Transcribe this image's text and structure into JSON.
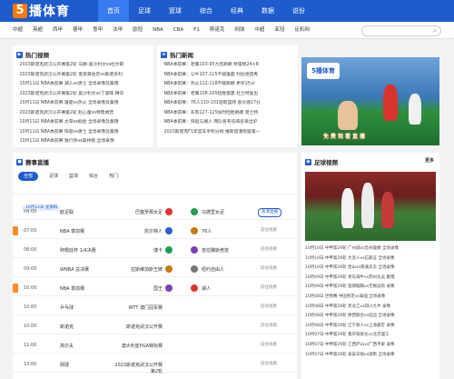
{
  "brand": {
    "mark": "5",
    "name": "播体育"
  },
  "main_nav": [
    "首页",
    "足球",
    "篮球",
    "综合",
    "经典",
    "数据",
    "说份"
  ],
  "sub_nav": [
    "中超",
    "英超",
    "西甲",
    "德甲",
    "意甲",
    "法甲",
    "欧冠",
    "NBA",
    "CBA",
    "F1",
    "斯诺克",
    "网球",
    "中超",
    "亚冠",
    "足彩网"
  ],
  "search": {
    "placeholder": ""
  },
  "hot_videos": {
    "title": "热门视频",
    "items": [
      "2023斯诺克武汉公开赛第2轮 马赫-奥沙利文vs杜尔斯",
      "2023斯诺克武汉公开赛第2轮 墨索美伯尼vs斯诺多利",
      "10月11日 NBA季前赛 湖人vs勇士 全场录像及集锦",
      "2023斯诺克武汉公开赛第2轮 奥沙利文vs丁俊晖 精华",
      "10月11日 NBA季前赛 雄鹿vs热火 全场录像及集锦",
      "2023斯诺克武汉公开赛第2轮 赵心童vs特鲁姆普",
      "10月11日 NBA季前赛 太阳vs掘金 全场录像及集锦",
      "10月11日 NBA季前赛 快船vs勇士 全场录像及集锦",
      "10月11日 NBA季前赛 独行侠vs森林狼 全场录像"
    ]
  },
  "hot_news": {
    "title": "热门新闻",
    "items": [
      "NBA季前赛：老鹰103-95力克鹈鹕 特雷杨24+8",
      "NBA季前赛：公牛107-115不敌雄鹿 利拉德首秀",
      "NBA季前赛：热火112-118不敌鹈鹕 希罗25分",
      "NBA季前赛：老鹰108-105险胜雷霆 杜兰特复出",
      "NBA季前赛：76人110-101轻取篮网 恩比德27分",
      "NBA季前赛：灰熊127-125加时险胜鹈鹕 莫兰特",
      "NBA季前赛：快船与湖人 两队各有伤病名单出炉",
      "2023斯诺克F1年度车手积分榜 维斯塔潘稳居第一"
    ]
  },
  "promo": {
    "badge": "5播体育",
    "slogan": "免费观看直播"
  },
  "schedule": {
    "title": "赛事直播",
    "tabs": [
      "全部",
      "足球",
      "篮球",
      "综合",
      "热门"
    ],
    "date": "10月12日 星期四",
    "rows": [
      {
        "time": "04:00",
        "league": "欧足联",
        "home": "巴塞罗那女足",
        "away": "马德里女足",
        "button": "高清直播",
        "live": true,
        "hot": false
      },
      {
        "time": "07:00",
        "league": "NBA 季前赛",
        "home": "凯尔特人",
        "away": "76人",
        "button": "前往观看",
        "live": false,
        "hot": true
      },
      {
        "time": "08:00",
        "league": "阿根廷杯 1/4决赛",
        "home": "博卡",
        "away": "普拉滕斯竞技",
        "button": "前往观看",
        "live": false,
        "hot": false
      },
      {
        "time": "09:00",
        "league": "WNBA 总决赛",
        "home": "拉斯维加斯王牌",
        "away": "纽约自由人",
        "button": "前往观看",
        "live": false,
        "hot": false
      },
      {
        "time": "10:00",
        "league": "NBA 季前赛",
        "home": "国王",
        "away": "湖人",
        "button": "前往观看",
        "live": false,
        "hot": true
      },
      {
        "time": "10:00",
        "league": "乒乓球",
        "home": "WTT 澳门冠军赛",
        "away": "",
        "button": "前往观看",
        "live": false,
        "hot": false
      },
      {
        "time": "10:00",
        "league": "斯诺克",
        "home": "斯诺克武汉公开赛",
        "away": "",
        "button": "前往观看",
        "live": false,
        "hot": false
      },
      {
        "time": "11:00",
        "league": "高尔夫",
        "home": "澳大利亚PGA锦标赛",
        "away": "",
        "button": "前往观看",
        "live": false,
        "hot": false
      },
      {
        "time": "13:00",
        "league": "网球",
        "home": "2023斯诺克武汉公开赛 第2轮",
        "away": "",
        "button": "前往观看",
        "live": false,
        "hot": false
      }
    ]
  },
  "soccer_videos": {
    "title": "足球视频",
    "more": "更多",
    "items": [
      "10月10日 中甲第29轮 广州城vs沧州雄狮 全场录像",
      "10月10日 中甲第29轮 大连人vs石家庄 全场录像",
      "10月10日 中甲第29轮 昆山vs南通支云 全场录像",
      "10月09日 中甲第29轮 青岛海牛vs苏州东吴 集锦",
      "10月09日 中甲第29轮 淄博蹴鞠vs无锡吴钩 录像",
      "10月08日 世预赛 中国男足vs泰国 全场录像",
      "10月08日 中甲第29轮 黑龙江vs四川九牛 录像",
      "10月08日 中甲第29轮 陕西联合vs延边 全场录像",
      "10月08日 中甲第29轮 辽宁铁人vs上海嘉定 录像",
      "10月07日 中甲第29轮 重庆铜梁龙vs北京理工",
      "10月07日 中甲第29轮 江西庐山vs广西平果 录像",
      "10月07日 中甲第29轮 泰安天贶vs湖南 全场录像"
    ]
  }
}
